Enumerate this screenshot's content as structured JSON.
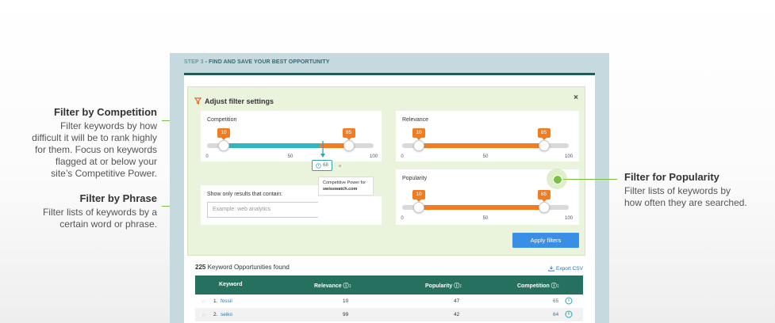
{
  "annotations": {
    "competition": {
      "title": "Filter by Competition",
      "lines": [
        "Filter keywords by how",
        "difficult it will be to rank highly",
        "for them. Focus on keywords",
        "flagged at or below your",
        "site’s Competitive Power."
      ]
    },
    "phrase": {
      "title": "Filter by Phrase",
      "lines": [
        "Filter lists of keywords by a",
        "certain word or phrase."
      ]
    },
    "popularity": {
      "title": "Filter for Popularity",
      "lines": [
        "Filter lists of keywords by",
        "how often they are searched."
      ]
    }
  },
  "step": {
    "number": "STEP 3",
    "label": "- FIND AND SAVE YOUR BEST OPPORTUNITY"
  },
  "filters": {
    "title": "Adjust filter settings",
    "close": "×",
    "competition": {
      "label": "Competition",
      "low": "10",
      "high": "85",
      "min_fraction": 0.1,
      "max_fraction": 0.85,
      "marker_fraction": 0.68,
      "ticks": [
        "0",
        "50",
        "100"
      ]
    },
    "relevance": {
      "label": "Relevance",
      "low": "10",
      "high": "85",
      "min_fraction": 0.1,
      "max_fraction": 0.85,
      "ticks": [
        "0",
        "50",
        "100"
      ]
    },
    "popularity": {
      "label": "Popularity",
      "low": "10",
      "high": "85",
      "min_fraction": 0.1,
      "max_fraction": 0.85,
      "ticks": [
        "0",
        "50",
        "100"
      ]
    },
    "competitive_power": {
      "value": "68",
      "tooltip_line1": "Competitive Power for",
      "tooltip_line2": "swisswatch.com"
    },
    "phrase": {
      "label": "Show only results that contain:",
      "placeholder": "Example: web analytics"
    },
    "apply": "Apply filters"
  },
  "results": {
    "count": "225",
    "count_label": "Keyword Opportunities found",
    "export": "Export CSV",
    "columns": {
      "keyword": "Keyword",
      "relevance": "Relevance",
      "popularity": "Popularity",
      "competition": "Competition"
    },
    "rows": [
      {
        "num": "1.",
        "keyword": "fossil",
        "relevance": "10",
        "popularity": "47",
        "competition": "65"
      },
      {
        "num": "2.",
        "keyword": "seiko",
        "relevance": "99",
        "popularity": "42",
        "competition": "64"
      }
    ]
  },
  "colors": {
    "accent_green": "#7ac143",
    "header_green": "#26705f",
    "slider_orange": "#f47c20",
    "slider_teal": "#2fb6c2",
    "button_blue": "#3b8ee6"
  }
}
